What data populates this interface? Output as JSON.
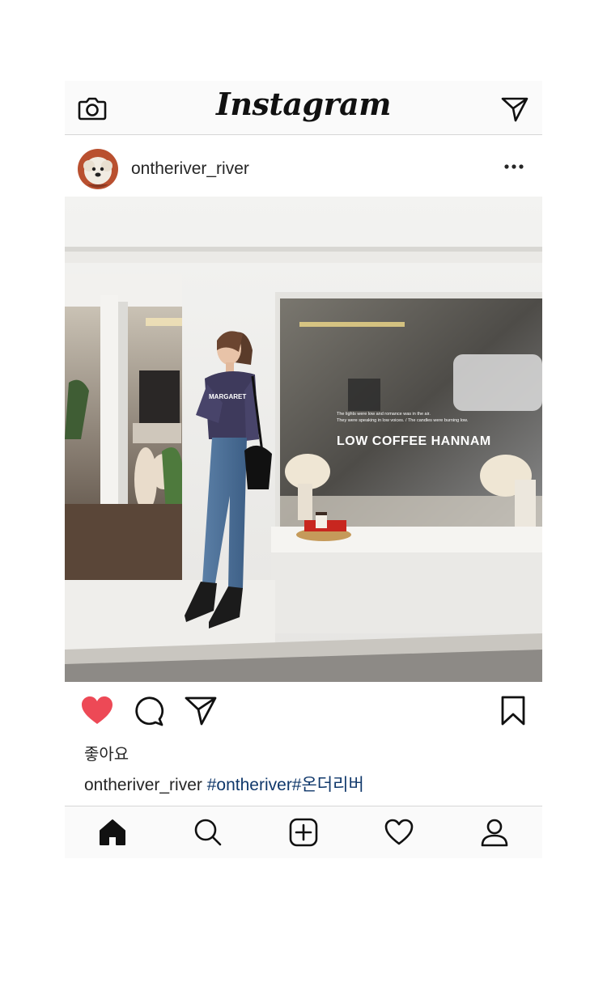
{
  "app": {
    "logo_text": "Instagram",
    "icons": {
      "camera": "camera-icon",
      "direct": "paper-plane-icon"
    }
  },
  "post": {
    "username": "ontheriver_river",
    "more_icon": "ellipsis-icon",
    "photo": {
      "subject": "woman leaning against cafe wall",
      "window_lines": [
        "The lights were low and romance was in the air.",
        "They were speaking in low voices. / The candles were burning low."
      ],
      "window_title": "LOW COFFEE HANNAM",
      "shirt_text": "MARGARET"
    },
    "actions": {
      "like_icon": "heart-icon",
      "liked": true,
      "comment_icon": "comment-icon",
      "share_icon": "paper-plane-icon",
      "save_icon": "bookmark-icon"
    },
    "likes_label": "좋아요",
    "caption": {
      "username": "ontheriver_river",
      "hashtags": "#ontheriver#온더리버"
    }
  },
  "tabbar": {
    "items": [
      "home-icon",
      "search-icon",
      "add-post-icon",
      "activity-heart-icon",
      "profile-icon"
    ]
  },
  "colors": {
    "like_red": "#ed4956",
    "hashtag_blue": "#10386b",
    "bar_background": "#fafafa"
  }
}
